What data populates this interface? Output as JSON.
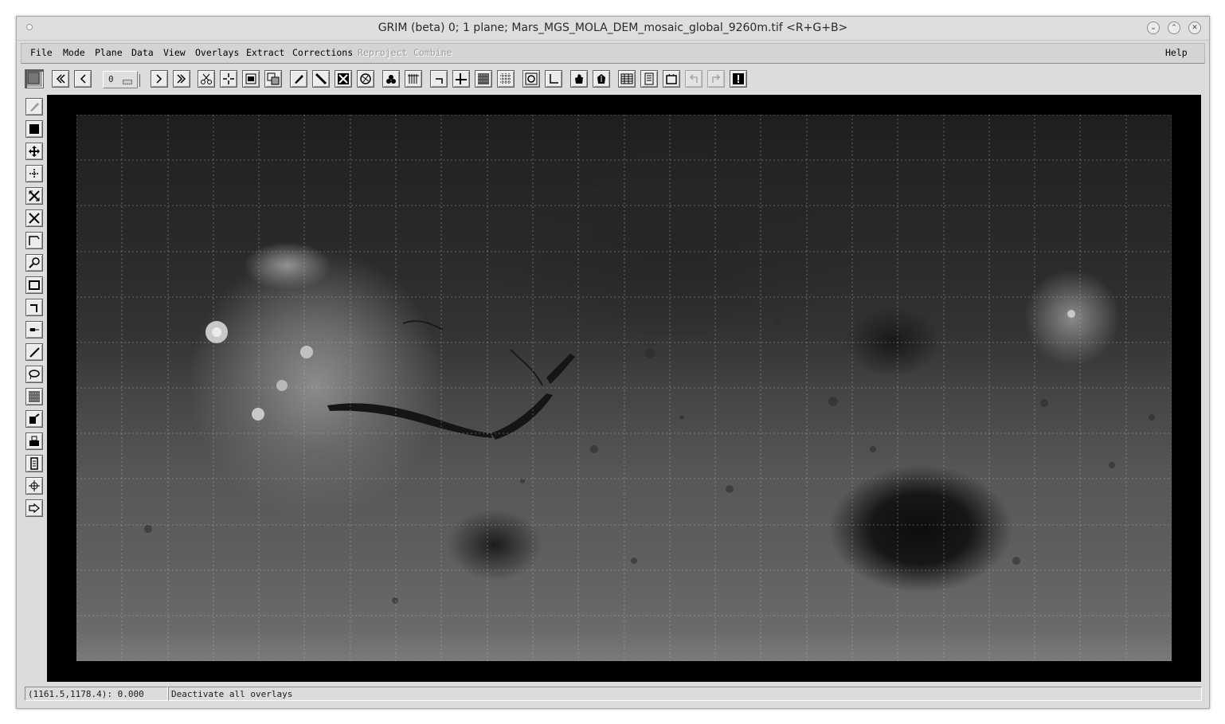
{
  "window": {
    "title": "GRIM (beta) 0;  1 plane;  Mars_MGS_MOLA_DEM_mosaic_global_9260m.tif <R+G+B>",
    "controls": [
      "minimize-icon",
      "maximize-icon",
      "close-icon"
    ]
  },
  "menubar": {
    "items": [
      {
        "label": "File",
        "enabled": true
      },
      {
        "label": "Mode",
        "enabled": true
      },
      {
        "label": "Plane",
        "enabled": true
      },
      {
        "label": "Data",
        "enabled": true
      },
      {
        "label": "View",
        "enabled": true
      },
      {
        "label": "Overlays",
        "enabled": true
      },
      {
        "label": "Extract",
        "enabled": true
      },
      {
        "label": "Corrections",
        "enabled": true
      },
      {
        "label": "Reproject",
        "enabled": false
      },
      {
        "label": "Combine",
        "enabled": false
      }
    ],
    "help": "Help"
  },
  "toolbar": {
    "plane_number": "0",
    "buttons": [
      "current-plane-icon",
      "first-plane-icon",
      "previous-plane-icon",
      "next-plane-icon",
      "last-plane-icon",
      "cut-icon",
      "crosshair-icon",
      "frame-icon",
      "copy-icon",
      "pencil-icon",
      "line-icon",
      "clear-icon",
      "globe-icon",
      "stars-icon",
      "grid-lines-icon",
      "corner-icon",
      "cross-icon",
      "dither-icon",
      "mesh-icon",
      "target-icon",
      "axes-icon",
      "hand-icon",
      "pan-icon",
      "table-icon",
      "notes-icon",
      "camera-icon",
      "undo-icon",
      "redo-icon",
      "alert-icon"
    ]
  },
  "left_tools": [
    "pencil-mode-icon",
    "select-icon",
    "move-icon",
    "rotate-icon",
    "expand-icon",
    "shrink-icon",
    "measure-icon",
    "zoom-icon",
    "box-icon",
    "corner-tool-icon",
    "slider-icon",
    "draw-line-icon",
    "lasso-icon",
    "texture-icon",
    "spray-icon",
    "stamp-icon",
    "document-icon",
    "center-icon",
    "play-icon"
  ],
  "viewport": {
    "image_name": "Mars_MGS_MOLA_DEM_mosaic_global_9260m.tif",
    "grid_visible": true,
    "grid_columns": 24,
    "grid_rows": 12
  },
  "status": {
    "coords": "(1161.5,1178.4): 0.000",
    "message": "Deactivate all overlays"
  }
}
